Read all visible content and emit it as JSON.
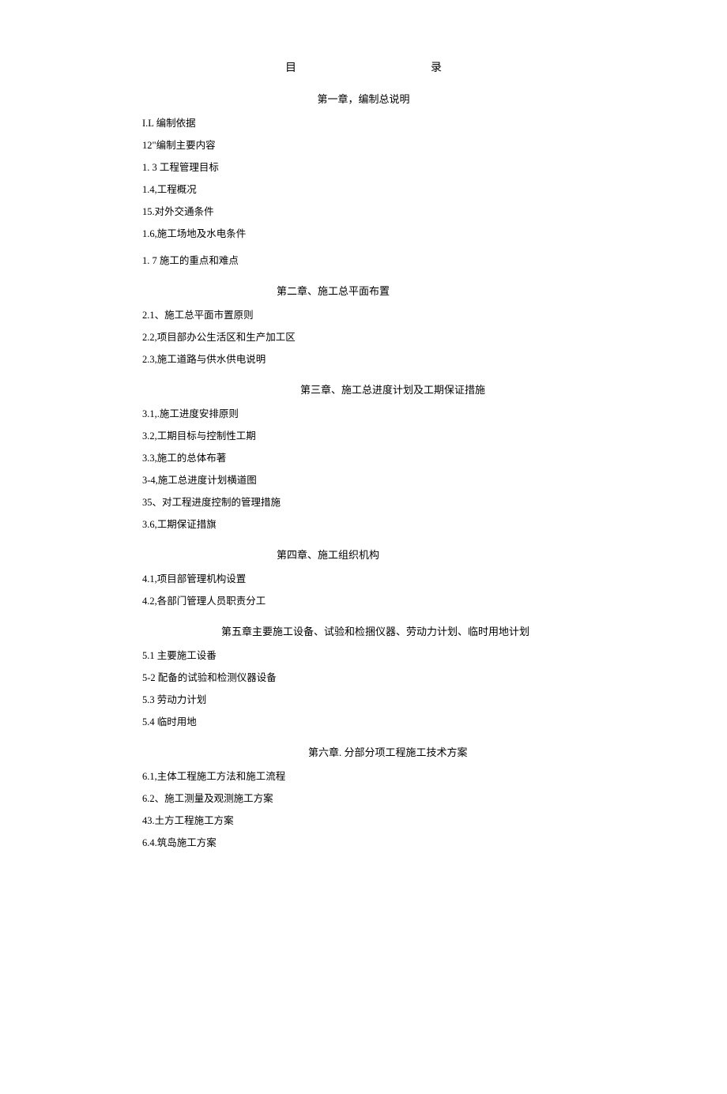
{
  "title": {
    "left": "目",
    "right": "录"
  },
  "chapters": [
    {
      "heading": "第一章，编制总说明",
      "headingClass": "chapter",
      "items": [
        {
          "text": "I.L 编制依据"
        },
        {
          "text": "12\"编制主要内容"
        },
        {
          "text": "1. 3 工程管理目标"
        },
        {
          "text": "1.4,工程概况"
        },
        {
          "text": "15.对外交通条件"
        },
        {
          "text": "1.6,施工场地及水电条件"
        },
        {
          "text": "1. 7 施工的重点和难点",
          "gap": true
        }
      ]
    },
    {
      "heading": "第二章、施工总平面布置",
      "headingClass": "chapter-indent-1",
      "items": [
        {
          "text": "2.1、施工总平面市置原则"
        },
        {
          "text": "2.2,项目部办公生活区和生产加工区"
        },
        {
          "text": "2.3,施工道路与供水供电说明"
        }
      ]
    },
    {
      "heading": "第三章、施工总进度计划及工期保证措施",
      "headingClass": "chapter-indent-2",
      "items": [
        {
          "text": "3.1,.施工进度安排原则"
        },
        {
          "text": "3.2,工期目标与控制性工期"
        },
        {
          "text": "3.3,施工的总体布著"
        },
        {
          "text": "3-4,施工总进度计划横道图"
        },
        {
          "text": "35、对工程进度控制的管理措施"
        },
        {
          "text": "3.6,工期保证措旗"
        }
      ]
    },
    {
      "heading": "第四章、施工组织机构",
      "headingClass": "chapter-indent-1",
      "items": [
        {
          "text": "4.1,项目部管理机构设置"
        },
        {
          "text": "4.2,各部门管理人员职责分工"
        }
      ]
    },
    {
      "heading": "第五章主要施工设备、试验和检捆仪器、劳动力计划、临时用地计划",
      "headingClass": "chapter-indent-3",
      "items": [
        {
          "text": "5.1 主要施工设番"
        },
        {
          "text": "5-2 配备的试验和检测仪器设备"
        },
        {
          "text": "5.3 劳动力计划"
        },
        {
          "text": "5.4 临时用地"
        }
      ]
    },
    {
      "heading": "第六章. 分部分项工程施工技术方案",
      "headingClass": "chapter-indent-4",
      "items": [
        {
          "text": "6.1,主体工程施工方法和施工流程"
        },
        {
          "text": "6.2、施工测量及观测施工方案"
        },
        {
          "text": "43.土方工程施工方案"
        },
        {
          "text": "6.4.筑岛施工方案"
        }
      ]
    }
  ]
}
